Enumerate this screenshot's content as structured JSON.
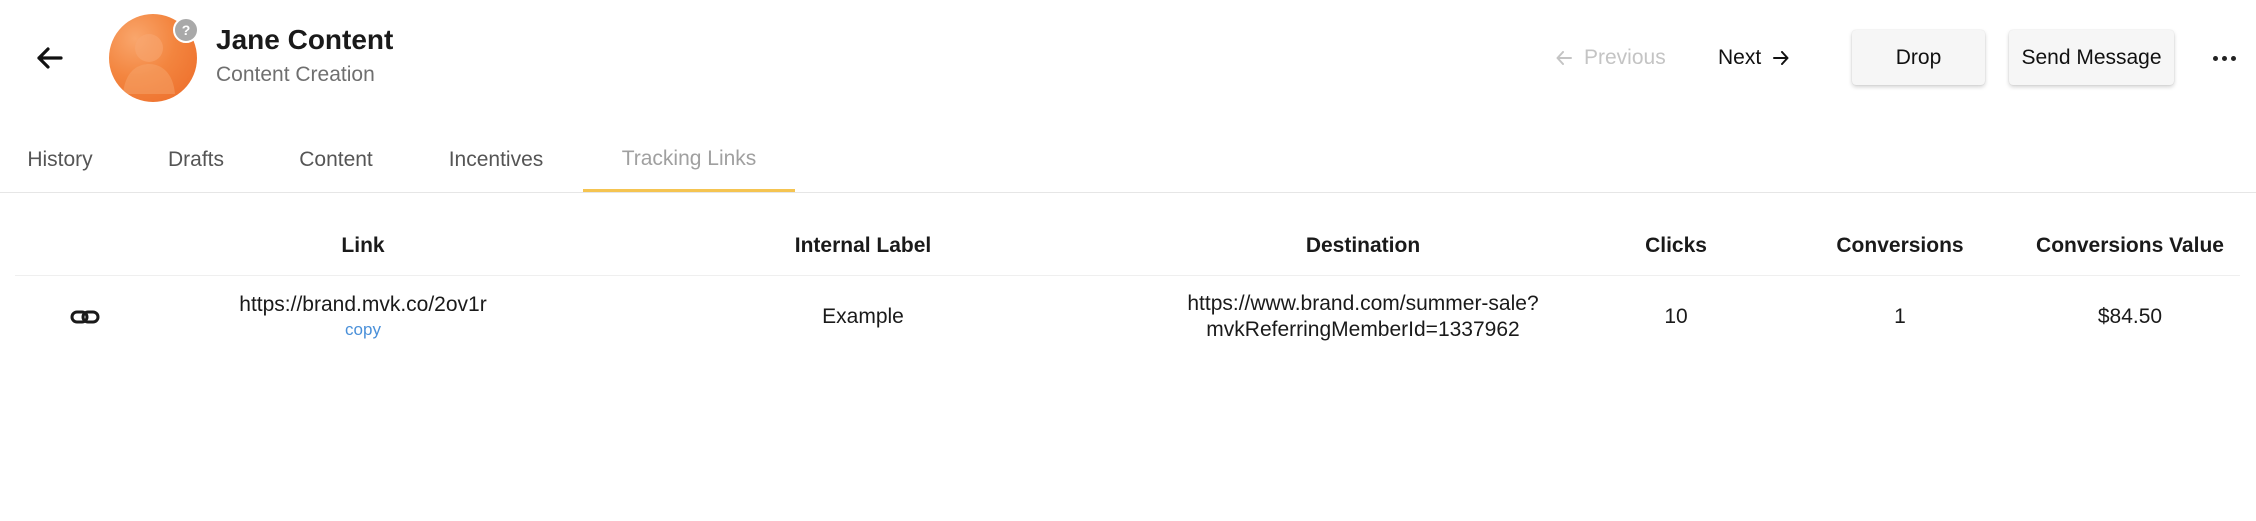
{
  "header": {
    "back_icon": "arrow-left-icon",
    "avatar_badge": "?",
    "name": "Jane Content",
    "subtitle": "Content Creation",
    "previous_label": "Previous",
    "next_label": "Next",
    "drop_label": "Drop",
    "send_message_label": "Send Message",
    "more_icon": "more-horizontal-icon"
  },
  "tabs": [
    {
      "label": "History",
      "active": false
    },
    {
      "label": "Drafts",
      "active": false
    },
    {
      "label": "Content",
      "active": false
    },
    {
      "label": "Incentives",
      "active": false
    },
    {
      "label": "Tracking Links",
      "active": true
    }
  ],
  "table": {
    "columns": [
      "Link",
      "Internal Label",
      "Destination",
      "Clicks",
      "Conversions",
      "Conversions Value"
    ],
    "rows": [
      {
        "icon": "link-icon",
        "link": "https://brand.mvk.co/2ov1r",
        "copy_label": "copy",
        "internal_label": "Example",
        "destination_line1": "https://www.brand.com/summer-sale?",
        "destination_line2": "mvkReferringMemberId=1337962",
        "clicks": "10",
        "conversions": "1",
        "conversions_value": "$84.50"
      }
    ]
  },
  "colors": {
    "accent_tab_underline": "#f5c451",
    "link_color": "#4a90d9",
    "avatar_orange": "#f3853f"
  }
}
